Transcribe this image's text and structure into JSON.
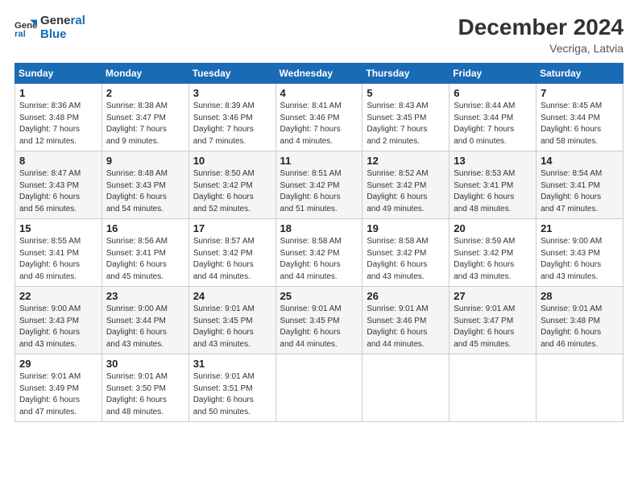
{
  "header": {
    "logo_line1": "General",
    "logo_line2": "Blue",
    "title": "December 2024",
    "subtitle": "Vecriga, Latvia"
  },
  "days_of_week": [
    "Sunday",
    "Monday",
    "Tuesday",
    "Wednesday",
    "Thursday",
    "Friday",
    "Saturday"
  ],
  "weeks": [
    [
      {
        "day": "1",
        "info": "Sunrise: 8:36 AM\nSunset: 3:48 PM\nDaylight: 7 hours\nand 12 minutes."
      },
      {
        "day": "2",
        "info": "Sunrise: 8:38 AM\nSunset: 3:47 PM\nDaylight: 7 hours\nand 9 minutes."
      },
      {
        "day": "3",
        "info": "Sunrise: 8:39 AM\nSunset: 3:46 PM\nDaylight: 7 hours\nand 7 minutes."
      },
      {
        "day": "4",
        "info": "Sunrise: 8:41 AM\nSunset: 3:46 PM\nDaylight: 7 hours\nand 4 minutes."
      },
      {
        "day": "5",
        "info": "Sunrise: 8:43 AM\nSunset: 3:45 PM\nDaylight: 7 hours\nand 2 minutes."
      },
      {
        "day": "6",
        "info": "Sunrise: 8:44 AM\nSunset: 3:44 PM\nDaylight: 7 hours\nand 0 minutes."
      },
      {
        "day": "7",
        "info": "Sunrise: 8:45 AM\nSunset: 3:44 PM\nDaylight: 6 hours\nand 58 minutes."
      }
    ],
    [
      {
        "day": "8",
        "info": "Sunrise: 8:47 AM\nSunset: 3:43 PM\nDaylight: 6 hours\nand 56 minutes."
      },
      {
        "day": "9",
        "info": "Sunrise: 8:48 AM\nSunset: 3:43 PM\nDaylight: 6 hours\nand 54 minutes."
      },
      {
        "day": "10",
        "info": "Sunrise: 8:50 AM\nSunset: 3:42 PM\nDaylight: 6 hours\nand 52 minutes."
      },
      {
        "day": "11",
        "info": "Sunrise: 8:51 AM\nSunset: 3:42 PM\nDaylight: 6 hours\nand 51 minutes."
      },
      {
        "day": "12",
        "info": "Sunrise: 8:52 AM\nSunset: 3:42 PM\nDaylight: 6 hours\nand 49 minutes."
      },
      {
        "day": "13",
        "info": "Sunrise: 8:53 AM\nSunset: 3:41 PM\nDaylight: 6 hours\nand 48 minutes."
      },
      {
        "day": "14",
        "info": "Sunrise: 8:54 AM\nSunset: 3:41 PM\nDaylight: 6 hours\nand 47 minutes."
      }
    ],
    [
      {
        "day": "15",
        "info": "Sunrise: 8:55 AM\nSunset: 3:41 PM\nDaylight: 6 hours\nand 46 minutes."
      },
      {
        "day": "16",
        "info": "Sunrise: 8:56 AM\nSunset: 3:41 PM\nDaylight: 6 hours\nand 45 minutes."
      },
      {
        "day": "17",
        "info": "Sunrise: 8:57 AM\nSunset: 3:42 PM\nDaylight: 6 hours\nand 44 minutes."
      },
      {
        "day": "18",
        "info": "Sunrise: 8:58 AM\nSunset: 3:42 PM\nDaylight: 6 hours\nand 44 minutes."
      },
      {
        "day": "19",
        "info": "Sunrise: 8:58 AM\nSunset: 3:42 PM\nDaylight: 6 hours\nand 43 minutes."
      },
      {
        "day": "20",
        "info": "Sunrise: 8:59 AM\nSunset: 3:42 PM\nDaylight: 6 hours\nand 43 minutes."
      },
      {
        "day": "21",
        "info": "Sunrise: 9:00 AM\nSunset: 3:43 PM\nDaylight: 6 hours\nand 43 minutes."
      }
    ],
    [
      {
        "day": "22",
        "info": "Sunrise: 9:00 AM\nSunset: 3:43 PM\nDaylight: 6 hours\nand 43 minutes."
      },
      {
        "day": "23",
        "info": "Sunrise: 9:00 AM\nSunset: 3:44 PM\nDaylight: 6 hours\nand 43 minutes."
      },
      {
        "day": "24",
        "info": "Sunrise: 9:01 AM\nSunset: 3:45 PM\nDaylight: 6 hours\nand 43 minutes."
      },
      {
        "day": "25",
        "info": "Sunrise: 9:01 AM\nSunset: 3:45 PM\nDaylight: 6 hours\nand 44 minutes."
      },
      {
        "day": "26",
        "info": "Sunrise: 9:01 AM\nSunset: 3:46 PM\nDaylight: 6 hours\nand 44 minutes."
      },
      {
        "day": "27",
        "info": "Sunrise: 9:01 AM\nSunset: 3:47 PM\nDaylight: 6 hours\nand 45 minutes."
      },
      {
        "day": "28",
        "info": "Sunrise: 9:01 AM\nSunset: 3:48 PM\nDaylight: 6 hours\nand 46 minutes."
      }
    ],
    [
      {
        "day": "29",
        "info": "Sunrise: 9:01 AM\nSunset: 3:49 PM\nDaylight: 6 hours\nand 47 minutes."
      },
      {
        "day": "30",
        "info": "Sunrise: 9:01 AM\nSunset: 3:50 PM\nDaylight: 6 hours\nand 48 minutes."
      },
      {
        "day": "31",
        "info": "Sunrise: 9:01 AM\nSunset: 3:51 PM\nDaylight: 6 hours\nand 50 minutes."
      },
      {
        "day": "",
        "info": ""
      },
      {
        "day": "",
        "info": ""
      },
      {
        "day": "",
        "info": ""
      },
      {
        "day": "",
        "info": ""
      }
    ]
  ]
}
